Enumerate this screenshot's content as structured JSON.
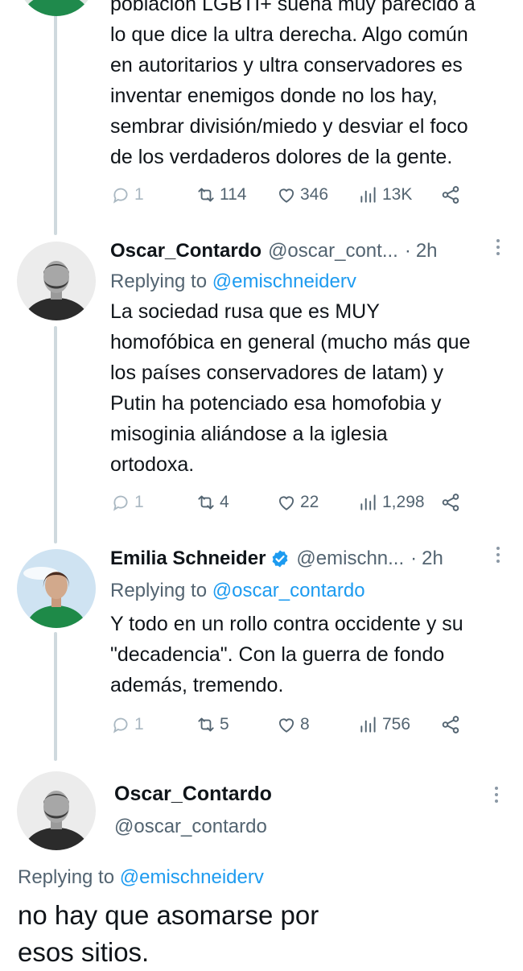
{
  "tweets": [
    {
      "body": "población LGBTI+ suena muy parecido a\nlo que dice la ultra derecha. Algo común\nen autoritarios y ultra conservadores es\ninventar enemigos donde no los hay,\nsembrar división/miedo y desviar el foco\nde los verdaderos dolores de la gente.",
      "replies": "1",
      "retweets": "114",
      "likes": "346",
      "views": "13K"
    },
    {
      "name": "Oscar_Contardo",
      "handle": "@oscar_cont...",
      "dot": "·",
      "time": "2h",
      "replying_prefix": "Replying to ",
      "replying_to": "@emischneiderv",
      "body": "La sociedad rusa que es MUY\nhomofóbica en general (mucho más que\nlos países conservadores de latam) y\nPutin ha potenciado esa homofobia y\nmisoginia aliándose a la iglesia\nortodoxa.",
      "replies": "1",
      "retweets": "4",
      "likes": "22",
      "views": "1,298"
    },
    {
      "name": "Emilia Schneider",
      "verified": true,
      "handle": "@emischn...",
      "dot": "·",
      "time": "2h",
      "replying_prefix": "Replying to ",
      "replying_to": "@oscar_contardo",
      "body": "Y todo en un rollo contra occidente y su\n\"decadencia\". Con la guerra de fondo\nademás, tremendo.",
      "replies": "1",
      "retweets": "5",
      "likes": "8",
      "views": "756"
    }
  ],
  "focused_tweet": {
    "name": "Oscar_Contardo",
    "handle": "@oscar_contardo",
    "replying_prefix": "Replying to ",
    "replying_to": "@emischneiderv",
    "body": "no hay que asomarse por\nesos sitios."
  },
  "colors": {
    "link": "#1d9bf0",
    "secondary": "#536471",
    "thread_line": "#cfd9de",
    "verified": "#1d9bf0"
  }
}
